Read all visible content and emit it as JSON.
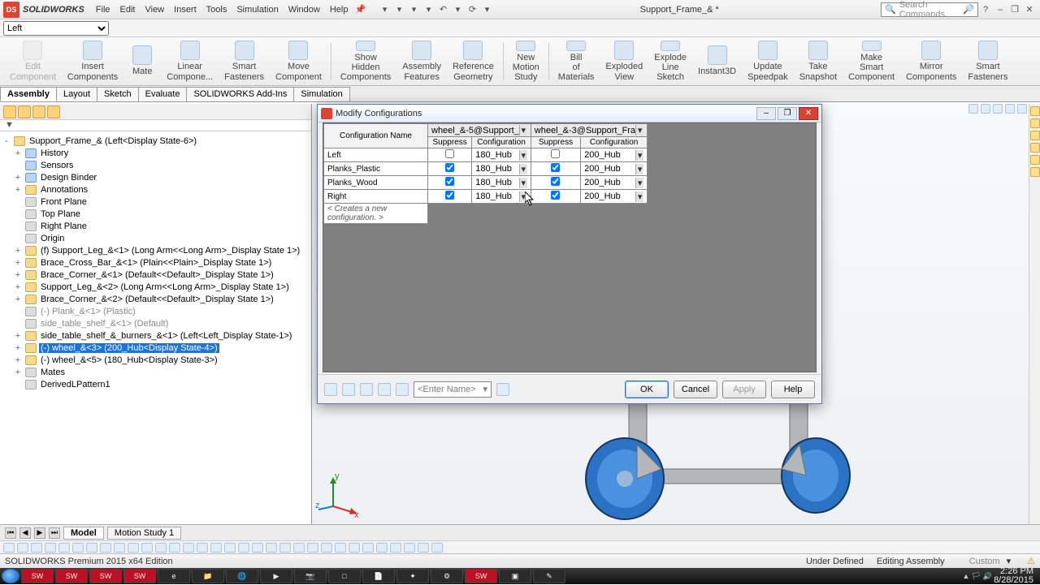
{
  "app": {
    "brand": "SOLIDWORKS",
    "doc_title": "Support_Frame_& *",
    "search_placeholder": "Search Commands"
  },
  "menus": [
    "File",
    "Edit",
    "View",
    "Insert",
    "Tools",
    "Simulation",
    "Window",
    "Help"
  ],
  "config_dropdown": "Left",
  "ribbon": [
    {
      "label": "Edit Component",
      "dis": true
    },
    {
      "label": "Insert Components"
    },
    {
      "label": "Mate"
    },
    {
      "label": "Linear Compone..."
    },
    {
      "label": "Smart Fasteners"
    },
    {
      "label": "Move Component"
    },
    {
      "label": "Show Hidden Components"
    },
    {
      "label": "Assembly Features"
    },
    {
      "label": "Reference Geometry"
    },
    {
      "label": "New Motion Study"
    },
    {
      "label": "Bill of Materials"
    },
    {
      "label": "Exploded View"
    },
    {
      "label": "Explode Line Sketch"
    },
    {
      "label": "Instant3D"
    },
    {
      "label": "Update Speedpak"
    },
    {
      "label": "Take Snapshot"
    },
    {
      "label": "Make Smart Component"
    },
    {
      "label": "Mirror Components"
    },
    {
      "label": "Smart Fasteners"
    }
  ],
  "tabs": [
    "Assembly",
    "Layout",
    "Sketch",
    "Evaluate",
    "SOLIDWORKS Add-Ins",
    "Simulation"
  ],
  "tree": [
    {
      "d": 0,
      "t": "Support_Frame_&  (Left<Display State-6>)",
      "ic": "gold",
      "exp": "-"
    },
    {
      "d": 1,
      "t": "History",
      "ic": "blue",
      "exp": "+"
    },
    {
      "d": 1,
      "t": "Sensors",
      "ic": "blue"
    },
    {
      "d": 1,
      "t": "Design Binder",
      "ic": "blue",
      "exp": "+"
    },
    {
      "d": 1,
      "t": "Annotations",
      "ic": "gold",
      "exp": "+"
    },
    {
      "d": 1,
      "t": "Front Plane",
      "ic": "grey"
    },
    {
      "d": 1,
      "t": "Top Plane",
      "ic": "grey"
    },
    {
      "d": 1,
      "t": "Right Plane",
      "ic": "grey"
    },
    {
      "d": 1,
      "t": "Origin",
      "ic": "grey"
    },
    {
      "d": 1,
      "t": "(f) Support_Leg_&<1> (Long Arm<<Long Arm>_Display State 1>)",
      "ic": "gold",
      "exp": "+"
    },
    {
      "d": 1,
      "t": "Brace_Cross_Bar_&<1> (Plain<<Plain>_Display State 1>)",
      "ic": "gold",
      "exp": "+"
    },
    {
      "d": 1,
      "t": "Brace_Corner_&<1> (Default<<Default>_Display State 1>)",
      "ic": "gold",
      "exp": "+"
    },
    {
      "d": 1,
      "t": "Support_Leg_&<2> (Long Arm<<Long Arm>_Display State 1>)",
      "ic": "gold",
      "exp": "+"
    },
    {
      "d": 1,
      "t": "Brace_Corner_&<2> (Default<<Default>_Display State 1>)",
      "ic": "gold",
      "exp": "+"
    },
    {
      "d": 1,
      "t": "(-) Plank_&<1> (Plastic)",
      "ic": "grey",
      "grey": true
    },
    {
      "d": 1,
      "t": "side_table_shelf_&<1> (Default)",
      "ic": "grey",
      "grey": true
    },
    {
      "d": 1,
      "t": "side_table_shelf_&_burners_&<1> (Left<Left_Display State-1>)",
      "ic": "gold",
      "exp": "+"
    },
    {
      "d": 1,
      "t": "(-) wheel_&<3> (200_Hub<Display State-4>)",
      "ic": "gold",
      "exp": "+",
      "sel": true
    },
    {
      "d": 1,
      "t": "(-) wheel_&<5> (180_Hub<Display State-3>)",
      "ic": "gold",
      "exp": "+"
    },
    {
      "d": 1,
      "t": "Mates",
      "ic": "grey",
      "exp": "+"
    },
    {
      "d": 1,
      "t": "DerivedLPattern1",
      "ic": "grey"
    }
  ],
  "dialog": {
    "title": "Modify Configurations",
    "colgroups": [
      "wheel_&-5@Support_",
      "wheel_&-3@Support_Fra"
    ],
    "cols": [
      "Configuration Name",
      "Suppress",
      "Configuration",
      "Suppress",
      "Configuration"
    ],
    "rows": [
      {
        "name": "Left",
        "s1": false,
        "c1": "180_Hub",
        "s2": false,
        "c2": "200_Hub"
      },
      {
        "name": "Planks_Plastic",
        "s1": true,
        "c1": "180_Hub",
        "s2": true,
        "c2": "200_Hub"
      },
      {
        "name": "Planks_Wood",
        "s1": true,
        "c1": "180_Hub",
        "s2": true,
        "c2": "200_Hub"
      },
      {
        "name": "Right",
        "s1": true,
        "c1": "180_Hub",
        "s2": true,
        "c2": "200_Hub"
      }
    ],
    "newrow": "< Creates a new configuration. >",
    "combo": "<Enter Name>",
    "buttons": {
      "ok": "OK",
      "cancel": "Cancel",
      "apply": "Apply",
      "help": "Help"
    }
  },
  "sheet_tabs": [
    "Model",
    "Motion Study 1"
  ],
  "status": {
    "edition": "SOLIDWORKS Premium 2015 x64 Edition",
    "def": "Under Defined",
    "mode": "Editing Assembly",
    "units": "Custom"
  },
  "clock": {
    "time": "2:26 PM",
    "date": "8/28/2015"
  }
}
